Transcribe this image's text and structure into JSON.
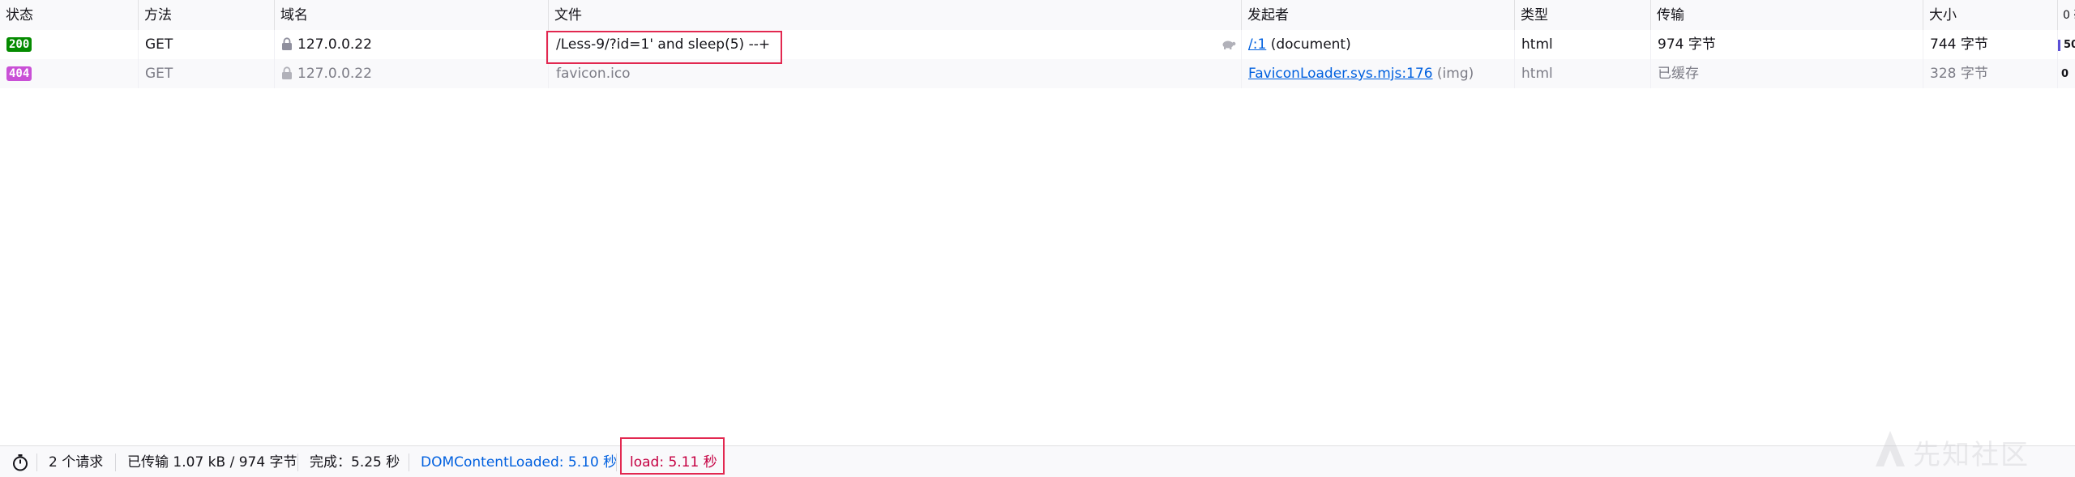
{
  "columns": [
    "状态",
    "方法",
    "域名",
    "文件",
    "发起者",
    "类型",
    "传输",
    "大小",
    "0 毫"
  ],
  "rows": [
    {
      "status": "200",
      "method": "GET",
      "domain": "127.0.0.22",
      "file": "/Less-9/?id=1' and sleep(5) --+",
      "initiator_link": "/:1",
      "initiator_extra": "(document)",
      "type": "html",
      "transferred": "974 字节",
      "size": "744 字节",
      "waterfall": "50"
    },
    {
      "status": "404",
      "method": "GET",
      "domain": "127.0.0.22",
      "file": "favicon.ico",
      "initiator_link": "FaviconLoader.sys.mjs:176",
      "initiator_extra": "(img)",
      "type": "html",
      "transferred": "已缓存",
      "size": "328 字节",
      "waterfall": "0"
    }
  ],
  "footer": {
    "requests": "2 个请求",
    "transferred": "已传输 1.07 kB / 974 字节",
    "finish": "完成：5.25 秒",
    "dom_content_loaded": "DOMContentLoaded: 5.10 秒",
    "load": "load: 5.11 秒"
  },
  "watermark": "先知社区",
  "colors": {
    "status_200": "#058b00",
    "status_404": "#c950d6",
    "link": "#0060df",
    "load": "#c50042",
    "highlight_box": "#e22850"
  },
  "icons": [
    "lock-icon",
    "turtle-icon",
    "stopwatch-icon"
  ]
}
